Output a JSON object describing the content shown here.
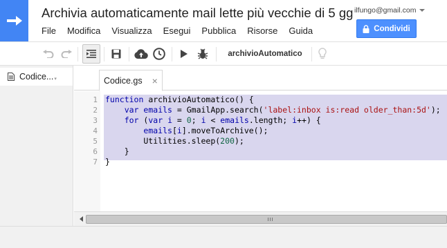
{
  "header": {
    "title": "Archivia automaticamente mail lette più vecchie di 5 gg",
    "menu": [
      "File",
      "Modifica",
      "Visualizza",
      "Esegui",
      "Pubblica",
      "Risorse",
      "Guida"
    ],
    "account_email": "ilfungo@gmail.com",
    "share_label": "Condividi"
  },
  "toolbar": {
    "function_name": "archivioAutomatico",
    "icons": [
      "undo-icon",
      "redo-icon",
      "indent-icon",
      "save-icon",
      "cloud-publish-icon",
      "clock-trigger-icon",
      "run-icon",
      "debug-bug-icon",
      "lightbulb-icon"
    ]
  },
  "sidebar": {
    "files": [
      {
        "label": "Codice...",
        "dropdown": "▾"
      }
    ]
  },
  "editor": {
    "tab_label": "Codice.gs",
    "tab_close": "×",
    "line_numbers": [
      "1",
      "2",
      "3",
      "4",
      "5",
      "6",
      "7"
    ],
    "code_lines": [
      "function archivioAutomatico() {",
      "    var emails = GmailApp.search('label:inbox is:read older_than:5d');",
      "    for (var i = 0; i < emails.length; i++) {",
      "        emails[i].moveToArchive();",
      "        Utilities.sleep(200);",
      "    }",
      "}"
    ]
  },
  "colors": {
    "brand_blue": "#4285f4",
    "share_button": "#4d90fe",
    "selection": "#d9d6ee",
    "keyword": "#0000aa",
    "string": "#aa1111",
    "number": "#116644"
  }
}
